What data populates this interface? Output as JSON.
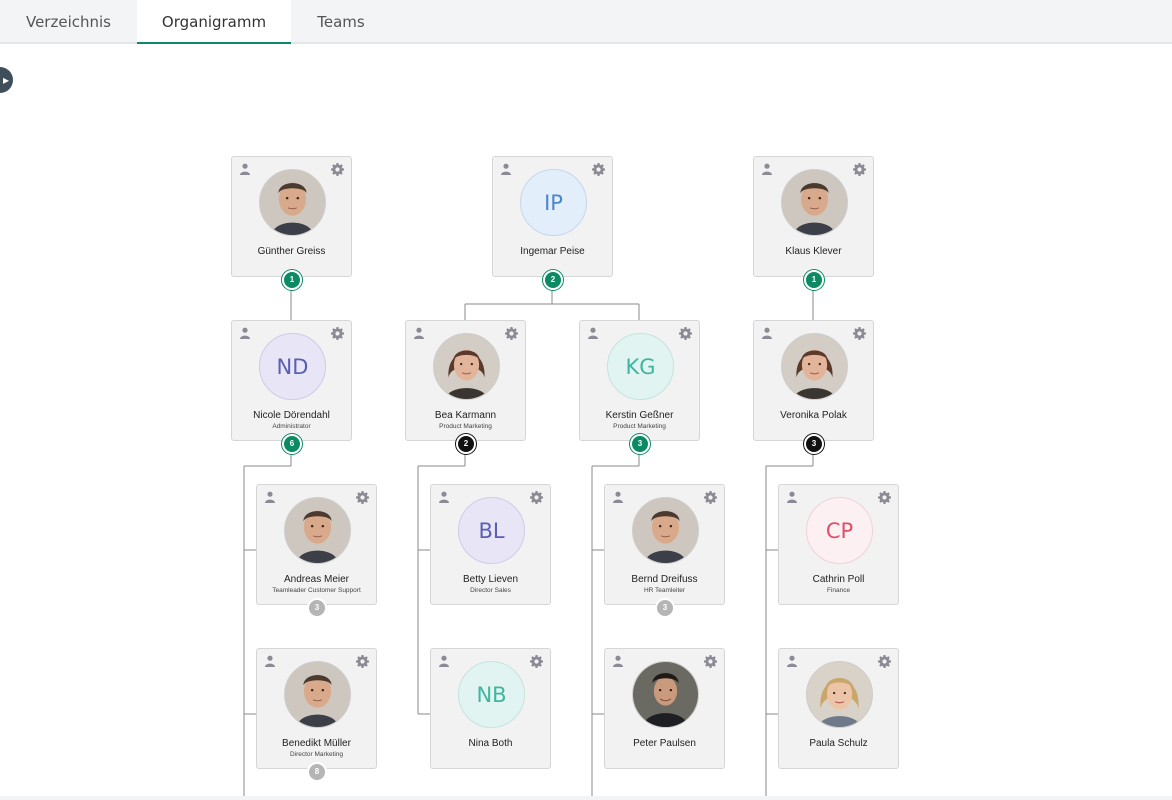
{
  "tabs": [
    {
      "label": "Verzeichnis",
      "active": false
    },
    {
      "label": "Organigramm",
      "active": true
    },
    {
      "label": "Teams",
      "active": false
    }
  ],
  "toggle_icon": "chevron-right-icon",
  "colors": {
    "accent": "#0a8a6a",
    "badge_green": "#0b8a63",
    "badge_black": "#111111",
    "badge_grey": "#b5b5b5"
  },
  "org": {
    "guenther": {
      "name": "Günther Greiss",
      "role": "",
      "badge": "1"
    },
    "ingemar": {
      "name": "Ingemar Peise",
      "initials": "IP",
      "role": "",
      "badge": "2"
    },
    "klaus": {
      "name": "Klaus Klever",
      "role": "",
      "badge": "1"
    },
    "nicole": {
      "name": "Nicole Dörendahl",
      "initials": "ND",
      "role": "Administrator",
      "badge": "6"
    },
    "bea": {
      "name": "Bea Karmann",
      "role": "Product Marketing",
      "badge": "2"
    },
    "kerstin": {
      "name": "Kerstin Geßner",
      "initials": "KG",
      "role": "Product Marketing",
      "badge": "3"
    },
    "veronika": {
      "name": "Veronika Polak",
      "role": "",
      "badge": "3"
    },
    "andreas": {
      "name": "Andreas Meier",
      "role": "Teamleader Customer Support",
      "badge": "3"
    },
    "betty": {
      "name": "Betty Lieven",
      "initials": "BL",
      "role": "Director Sales"
    },
    "bernd": {
      "name": "Bernd Dreifuss",
      "role": "HR Teamleiter",
      "badge": "3"
    },
    "cathrin": {
      "name": "Cathrin Poll",
      "initials": "CP",
      "role": "Finance"
    },
    "benedikt": {
      "name": "Benedikt Müller",
      "role": "Director Marketing",
      "badge": "8"
    },
    "nina": {
      "name": "Nina Both",
      "initials": "NB",
      "role": ""
    },
    "peter": {
      "name": "Peter Paulsen",
      "role": ""
    },
    "paula": {
      "name": "Paula Schulz",
      "role": ""
    }
  }
}
